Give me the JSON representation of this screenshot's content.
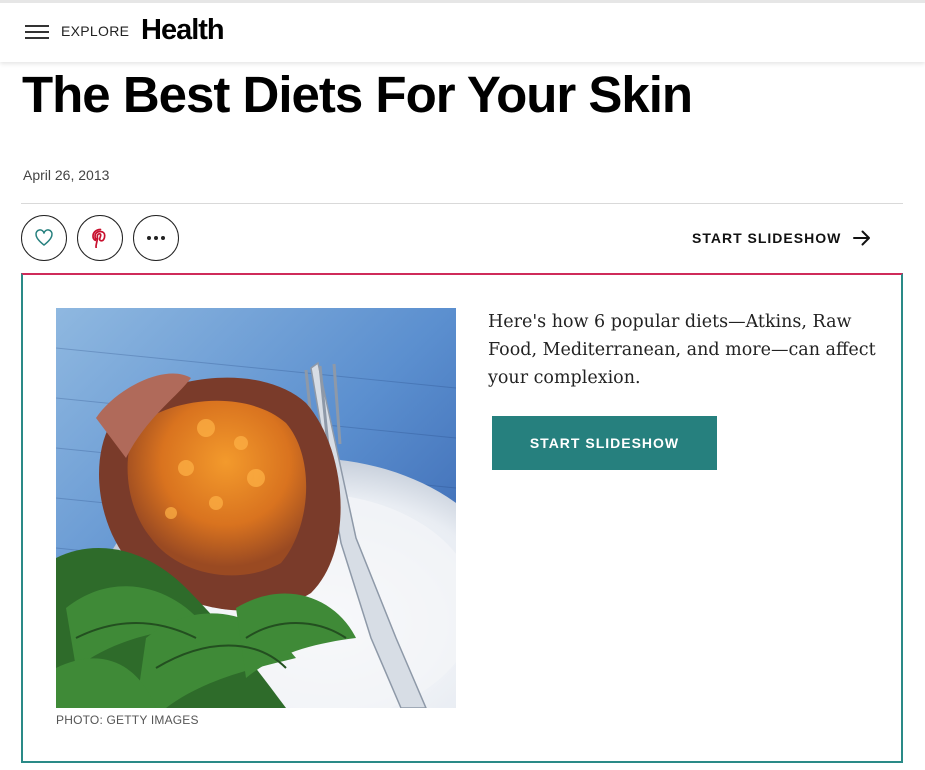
{
  "header": {
    "explore_label": "EXPLORE",
    "logo_text": "Health"
  },
  "article": {
    "title": "The Best Diets For Your Skin",
    "date": "April 26, 2013",
    "share": {
      "icons": [
        "heart-icon",
        "pinterest-icon",
        "more-icon"
      ]
    },
    "start_slideshow_link": "START SLIDESHOW"
  },
  "slideshow_card": {
    "description": "Here's how 6 popular diets—Atkins, Raw Food, Mediterranean, and more—can affect your complexion.",
    "cta_label": "START SLIDESHOW",
    "photo_credit": "PHOTO: GETTY IMAGES"
  },
  "colors": {
    "accent_teal": "#26807e",
    "card_top_border": "#cf2b5a",
    "pinterest_red": "#c8102e"
  }
}
